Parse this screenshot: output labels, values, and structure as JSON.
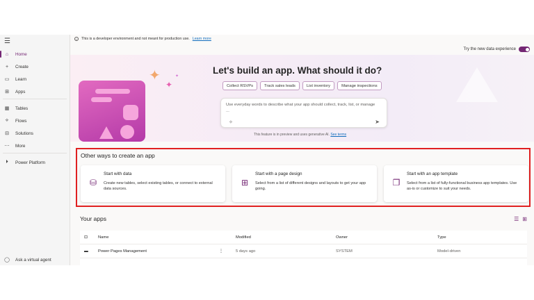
{
  "notice": {
    "text": "This is a developer environment and not meant for production use.",
    "link": "Learn more"
  },
  "toggle_label": "Try the new data experience",
  "sidebar": {
    "items": [
      {
        "label": "Home",
        "icon": "home-icon"
      },
      {
        "label": "Create",
        "icon": "plus-icon"
      },
      {
        "label": "Learn",
        "icon": "book-icon"
      },
      {
        "label": "Apps",
        "icon": "apps-icon"
      },
      {
        "label": "Tables",
        "icon": "table-icon"
      },
      {
        "label": "Flows",
        "icon": "flow-icon"
      },
      {
        "label": "Solutions",
        "icon": "solutions-icon"
      },
      {
        "label": "More",
        "icon": "more-icon"
      },
      {
        "label": "Power Platform",
        "icon": "power-platform-icon"
      }
    ],
    "bottom": "Ask a virtual agent"
  },
  "hero": {
    "title": "Let's build an app. What should it do?",
    "chips": [
      "Collect RSVPs",
      "Track sales leads",
      "List inventory",
      "Manage inspections"
    ],
    "prompt_placeholder": "Use everyday words to describe what your app should collect, track, list, or manage ...",
    "footnote": "This feature is in preview and uses generative AI.",
    "footnote_link": "See terms"
  },
  "other_ways": {
    "title": "Other ways to create an app",
    "cards": [
      {
        "title": "Start with data",
        "desc": "Create new tables, select existing tables, or connect to external data sources."
      },
      {
        "title": "Start with a page design",
        "desc": "Select from a list of different designs and layouts to get your app going."
      },
      {
        "title": "Start with an app template",
        "desc": "Select from a list of fully-functional business app templates. Use as-is or customize to suit your needs."
      }
    ]
  },
  "your_apps": {
    "title": "Your apps",
    "columns": [
      "Name",
      "Modified",
      "Owner",
      "Type"
    ],
    "rows": [
      {
        "name": "Power Pages Management",
        "modified": "5 days ago",
        "owner": "SYSTEM",
        "type": "Model-driven"
      }
    ]
  },
  "colors": {
    "accent": "#742774",
    "highlight_border": "#e02020"
  }
}
